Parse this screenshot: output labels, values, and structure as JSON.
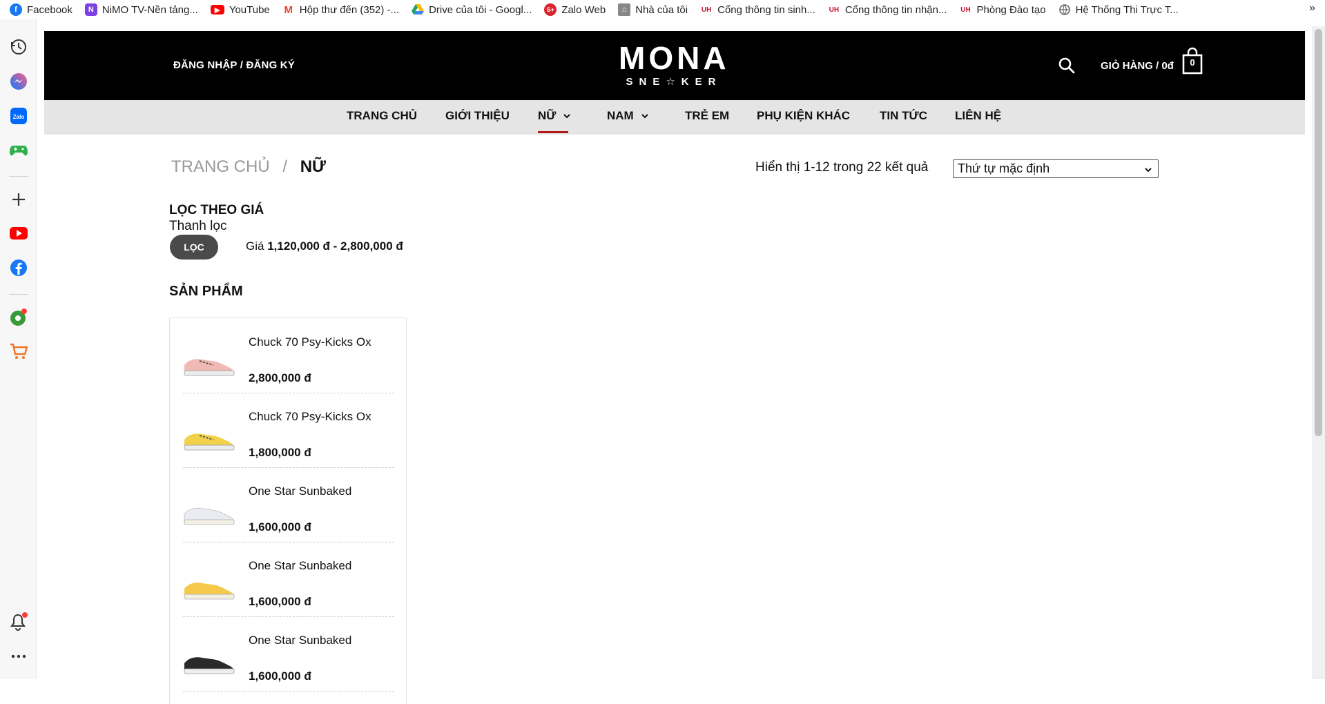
{
  "bookmarks": [
    {
      "label": "Facebook",
      "icon": "facebook-icon",
      "color": "#1877f2"
    },
    {
      "label": "NiMO TV-Nền tảng...",
      "icon": "nimo-icon",
      "color": "#7b3fe4"
    },
    {
      "label": "YouTube",
      "icon": "youtube-icon",
      "color": "#ff0000"
    },
    {
      "label": "Hộp thư đến (352) -...",
      "icon": "gmail-icon",
      "color": "#ea4335"
    },
    {
      "label": "Drive của tôi - Googl...",
      "icon": "drive-icon",
      "color": "#1fa463"
    },
    {
      "label": "Zalo Web",
      "icon": "zalo-icon",
      "color": "#d9242b"
    },
    {
      "label": "Nhà của tôi",
      "icon": "home-icon",
      "color": "#777777"
    },
    {
      "label": "Cổng thông tin sinh...",
      "icon": "university-icon",
      "color": "#c8102e"
    },
    {
      "label": "Cổng thông tin nhận...",
      "icon": "university-icon",
      "color": "#c8102e"
    },
    {
      "label": "Phòng Đào tạo",
      "icon": "university-icon",
      "color": "#c8102e"
    },
    {
      "label": "Hệ Thống Thi Trực T...",
      "icon": "globe-icon",
      "color": "#666666"
    }
  ],
  "bookmarks_more": "»",
  "sidebar": {
    "items": [
      "history-icon",
      "messenger-icon",
      "zalo-icon",
      "game-icon",
      "add-icon",
      "youtube-icon",
      "facebook-icon",
      "football-icon",
      "shopping-icon",
      "bell-icon",
      "more-icon"
    ]
  },
  "header": {
    "login_label": "ĐĂNG NHẬP / ĐĂNG KÝ",
    "logo_main": "MONA",
    "logo_sub": "SNE☆KER",
    "cart_label": "GIỎ HÀNG / 0đ",
    "cart_count": "0"
  },
  "nav": {
    "items": [
      {
        "label": "TRANG CHỦ",
        "has_dropdown": false
      },
      {
        "label": "GIỚI THIỆU",
        "has_dropdown": false
      },
      {
        "label": "NỮ",
        "has_dropdown": true,
        "active": true
      },
      {
        "label": "NAM",
        "has_dropdown": true
      },
      {
        "label": "TRẺ EM",
        "has_dropdown": false
      },
      {
        "label": "PHỤ KIỆN KHÁC",
        "has_dropdown": false
      },
      {
        "label": "TIN TỨC",
        "has_dropdown": false
      },
      {
        "label": "LIÊN HỆ",
        "has_dropdown": false
      }
    ],
    "accent": "#b01919"
  },
  "breadcrumb": {
    "home": "TRANG CHỦ",
    "separator": "/",
    "current": "NỮ"
  },
  "results": {
    "text": "Hiển thị 1-12 trong 22 kết quả"
  },
  "sort": {
    "selected": "Thứ tự mặc định"
  },
  "filter": {
    "title": "LỌC THEO GIÁ",
    "subtitle": "Thanh lọc",
    "button": "LỌC",
    "price_prefix": "Giá",
    "price_range": "1,120,000 đ - 2,800,000 đ"
  },
  "products": {
    "title": "SẢN PHẨM",
    "items": [
      {
        "name": "Chuck 70 Psy-Kicks Ox",
        "price": "2,800,000 đ",
        "color": "#f0b9b3"
      },
      {
        "name": "Chuck 70 Psy-Kicks Ox",
        "price": "1,800,000 đ",
        "color": "#f1d24a"
      },
      {
        "name": "One Star Sunbaked",
        "price": "1,600,000 đ",
        "color": "#e9edf2"
      },
      {
        "name": "One Star Sunbaked",
        "price": "1,600,000 đ",
        "color": "#f6c84b"
      },
      {
        "name": "One Star Sunbaked",
        "price": "1,600,000 đ",
        "color": "#2a2a2a"
      }
    ]
  }
}
